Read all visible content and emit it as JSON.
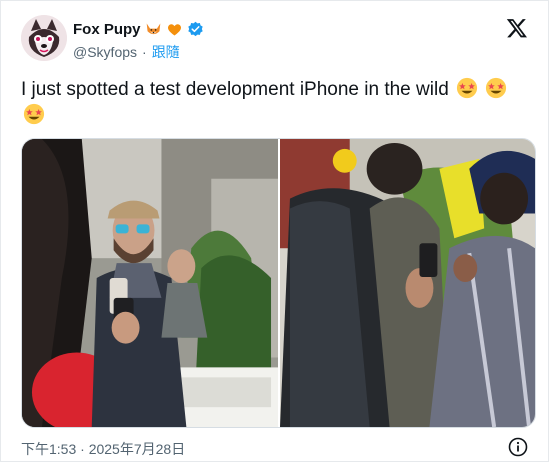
{
  "author": {
    "display_name": "Fox Pupy",
    "handle": "@Skyfops",
    "separator": "·",
    "follow_label": "跟隨",
    "badges": [
      "fox-emoji",
      "orange-heart-emoji",
      "verified-badge-icon"
    ]
  },
  "tweet": {
    "text": "I just spotted a test development iPhone in the wild"
  },
  "media": {
    "photos": [
      "photo-left",
      "photo-right"
    ]
  },
  "timestamp": "下午1:53 · 2025年7月28日",
  "colors": {
    "accent": "#1d9bf0",
    "secondary_text": "#536471",
    "primary_text": "#0f1419"
  }
}
